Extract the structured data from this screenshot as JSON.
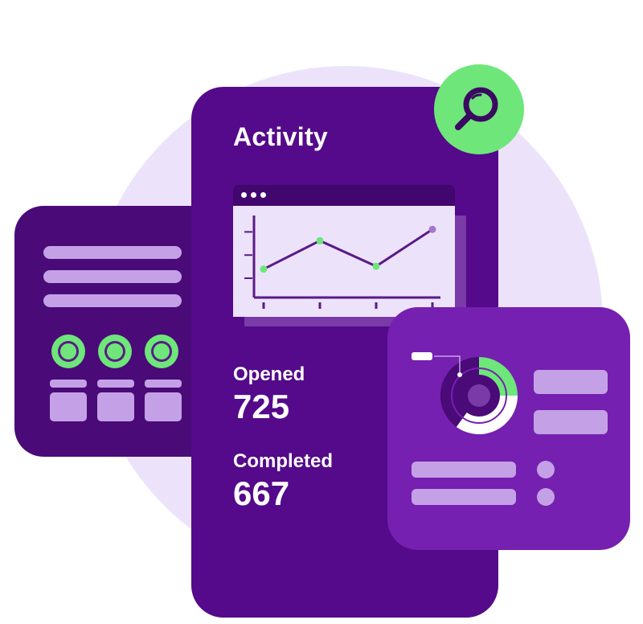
{
  "title": "Activity",
  "stats": {
    "opened_label": "Opened",
    "opened_value": "725",
    "completed_label": "Completed",
    "completed_value": "667"
  },
  "colors": {
    "background_circle": "#ece3fb",
    "main_card": "#540a8a",
    "left_card": "#4a0a78",
    "right_card": "#7520b0",
    "accent_green": "#6ee67a",
    "placeholder_lilac": "#c4a1e6"
  },
  "icons": {
    "search": "magnifier-icon"
  },
  "chart_data": {
    "type": "line",
    "x": [
      1,
      2,
      3,
      4
    ],
    "series": [
      {
        "values": [
          1.0,
          2.0,
          1.1,
          2.4
        ]
      }
    ],
    "ylim": [
      0,
      3
    ],
    "grid": false
  },
  "donut": {
    "segments": [
      {
        "value": 0.25,
        "color": "#6ee67a"
      },
      {
        "value": 0.35,
        "color": "#ffffff"
      },
      {
        "value": 0.4,
        "color": "#4a0a78"
      }
    ]
  }
}
